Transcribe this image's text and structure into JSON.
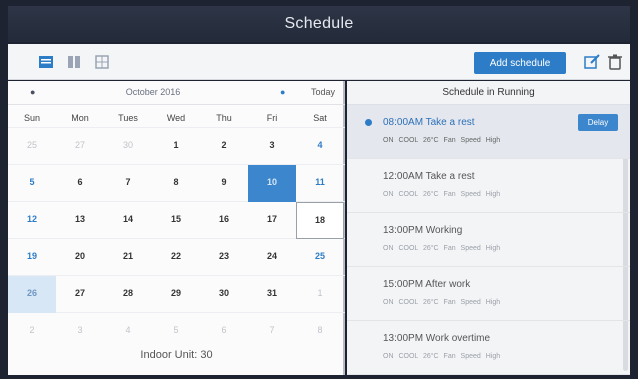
{
  "window": {
    "title": "Schedule"
  },
  "toolbar": {
    "add_label": "Add schedule",
    "icons": [
      "list-view-icon",
      "book-view-icon",
      "grid-view-icon",
      "edit-icon",
      "delete-icon"
    ]
  },
  "calendar": {
    "month_label": "October 2016",
    "today_label": "Today",
    "weekdays": [
      "Sun",
      "Mon",
      "Tues",
      "Wed",
      "Thu",
      "Fri",
      "Sat"
    ],
    "weeks": [
      [
        {
          "d": "25",
          "s": "other"
        },
        {
          "d": "27",
          "s": "other"
        },
        {
          "d": "30",
          "s": "other"
        },
        {
          "d": "1",
          "s": ""
        },
        {
          "d": "2",
          "s": ""
        },
        {
          "d": "3",
          "s": ""
        },
        {
          "d": "4",
          "s": "blue"
        }
      ],
      [
        {
          "d": "5",
          "s": "blue"
        },
        {
          "d": "6",
          "s": ""
        },
        {
          "d": "7",
          "s": ""
        },
        {
          "d": "8",
          "s": ""
        },
        {
          "d": "9",
          "s": ""
        },
        {
          "d": "10",
          "s": "selected"
        },
        {
          "d": "11",
          "s": "blue"
        }
      ],
      [
        {
          "d": "12",
          "s": "blue"
        },
        {
          "d": "13",
          "s": ""
        },
        {
          "d": "14",
          "s": ""
        },
        {
          "d": "15",
          "s": ""
        },
        {
          "d": "16",
          "s": ""
        },
        {
          "d": "17",
          "s": ""
        },
        {
          "d": "18",
          "s": "today"
        }
      ],
      [
        {
          "d": "19",
          "s": "blue"
        },
        {
          "d": "20",
          "s": ""
        },
        {
          "d": "21",
          "s": ""
        },
        {
          "d": "22",
          "s": ""
        },
        {
          "d": "23",
          "s": ""
        },
        {
          "d": "24",
          "s": ""
        },
        {
          "d": "25",
          "s": "blue"
        }
      ],
      [
        {
          "d": "26",
          "s": "highlight"
        },
        {
          "d": "27",
          "s": ""
        },
        {
          "d": "28",
          "s": ""
        },
        {
          "d": "29",
          "s": ""
        },
        {
          "d": "30",
          "s": ""
        },
        {
          "d": "31",
          "s": ""
        },
        {
          "d": "1",
          "s": "other"
        }
      ],
      [
        {
          "d": "2",
          "s": "other"
        },
        {
          "d": "3",
          "s": "other"
        },
        {
          "d": "4",
          "s": "other"
        },
        {
          "d": "5",
          "s": "other"
        },
        {
          "d": "6",
          "s": "other"
        },
        {
          "d": "7",
          "s": "other"
        },
        {
          "d": "8",
          "s": "other"
        }
      ]
    ],
    "indoor_unit": "Indoor Unit: 30"
  },
  "running": {
    "title": "Schedule in Running",
    "delay_label": "Delay",
    "items": [
      {
        "time": "08:00AM Take a rest",
        "detail": "ON  COOL 26°C  Fan Speed High",
        "active": true
      },
      {
        "time": "12:00AM Take a rest",
        "detail": "ON  COOL 26°C  Fan Speed High",
        "active": false
      },
      {
        "time": "13:00PM Working",
        "detail": "ON  COOL 26°C  Fan Speed High",
        "active": false
      },
      {
        "time": "15:00PM After work",
        "detail": "ON  COOL 26°C  Fan Speed High",
        "active": false
      },
      {
        "time": "13:00PM Work overtime",
        "detail": "ON  COOL 26°C  Fan Speed High",
        "active": false
      }
    ]
  },
  "colors": {
    "accent": "#2d7cc7",
    "titlebar": "#2a3142"
  }
}
